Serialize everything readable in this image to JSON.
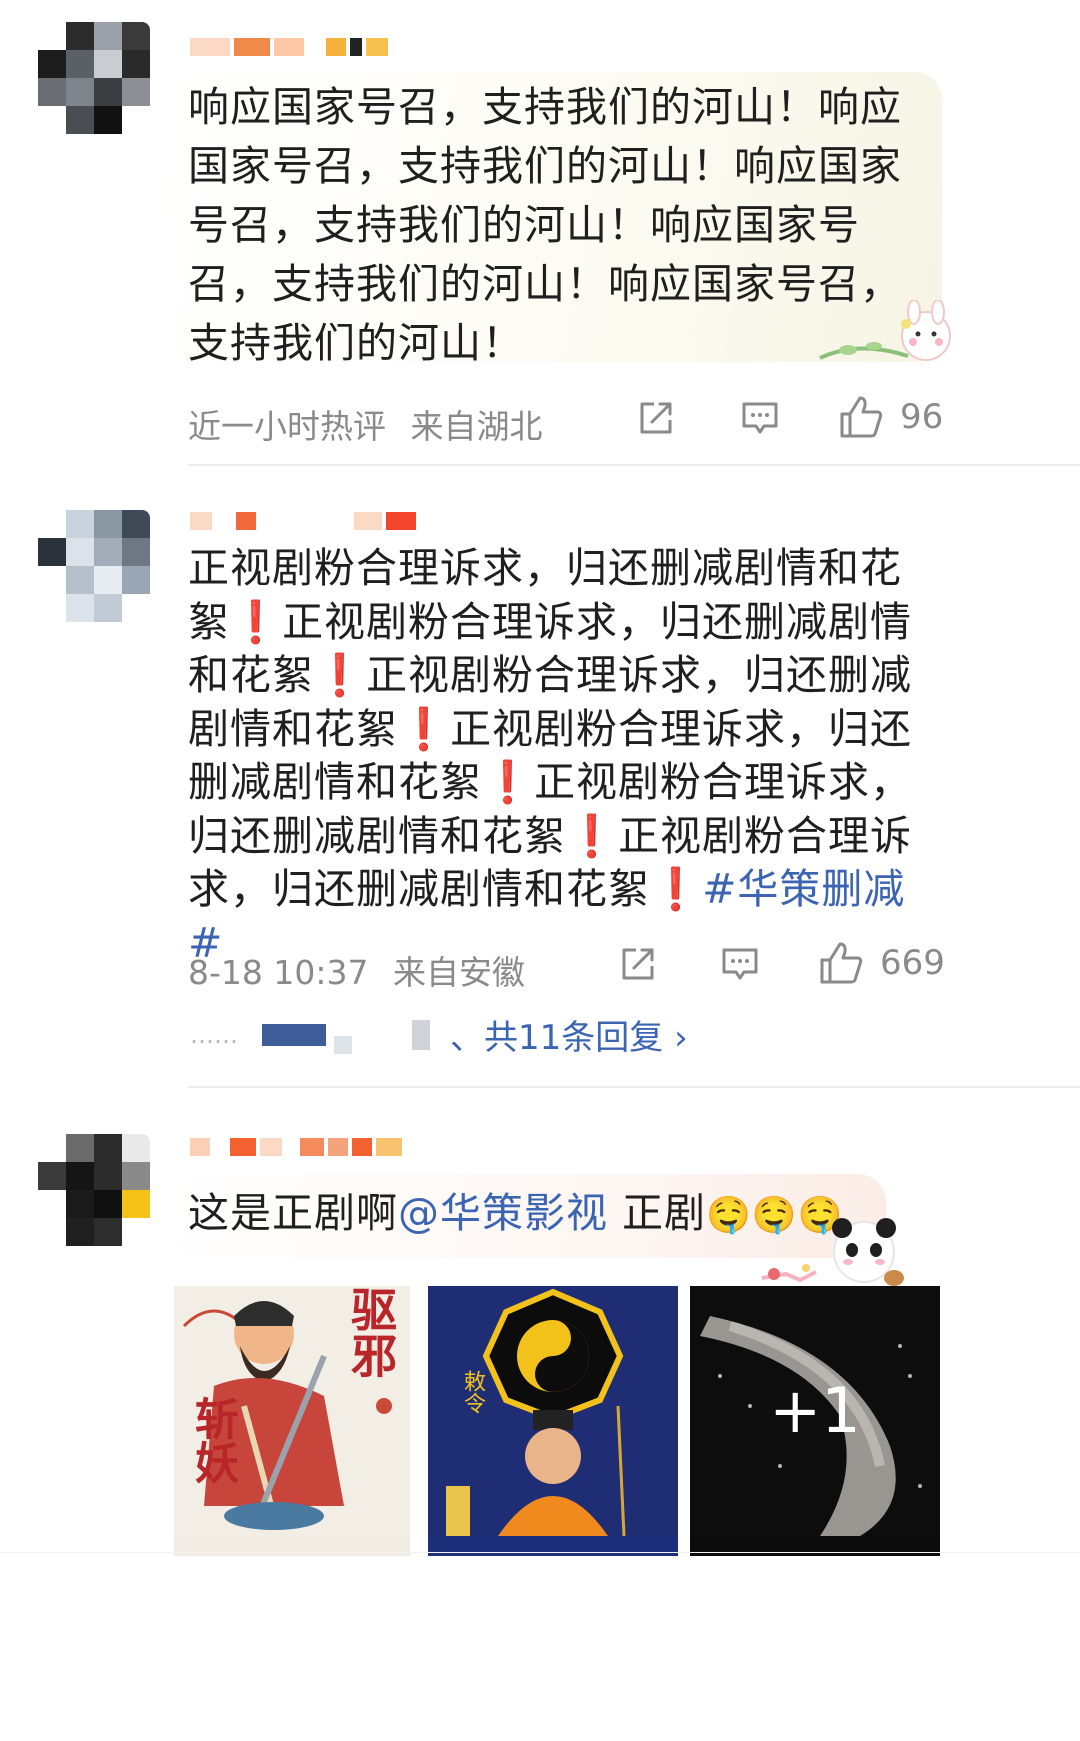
{
  "comments": [
    {
      "text": "响应国家号召，支持我们的河山！响应国家号召，支持我们的河山！响应国家号召，支持我们的河山！响应国家号召，支持我们的河山！响应国家号召，支持我们的河山！",
      "time": "近一小时热评",
      "location": "来自湖北",
      "likes": "96",
      "icons": {
        "share": "share-icon",
        "comment": "comment-icon",
        "like": "thumbs-up-icon"
      }
    },
    {
      "segments": [
        "正视剧粉合理诉求，归还删减剧情和花絮",
        "❗",
        "正视剧粉合理诉求，归还删减剧情和花絮",
        "❗",
        "正视剧粉合理诉求，归还删减剧情和花絮",
        "❗",
        "正视剧粉合理诉求，归还删减剧情和花絮",
        "❗",
        "正视剧粉合理诉求，归还删减剧情和花絮",
        "❗",
        "正视剧粉合理诉求，归还删减剧情和花絮",
        "❗"
      ],
      "hashtag": "#华策删减#",
      "time": "8-18 10:37",
      "location": "来自安徽",
      "likes": "669",
      "replies_label": "、共11条回复 ›",
      "replies_dots": "……"
    },
    {
      "text_before": "这是正剧啊",
      "mention": "@华策影视",
      "text_after": " 正剧",
      "emojis": [
        "🤤",
        "🤤",
        "🤤"
      ],
      "images": [
        {
          "label": "斩妖",
          "top_label": "驱邪"
        },
        {
          "label": "敕令"
        },
        {
          "label": "+1"
        }
      ]
    }
  ]
}
